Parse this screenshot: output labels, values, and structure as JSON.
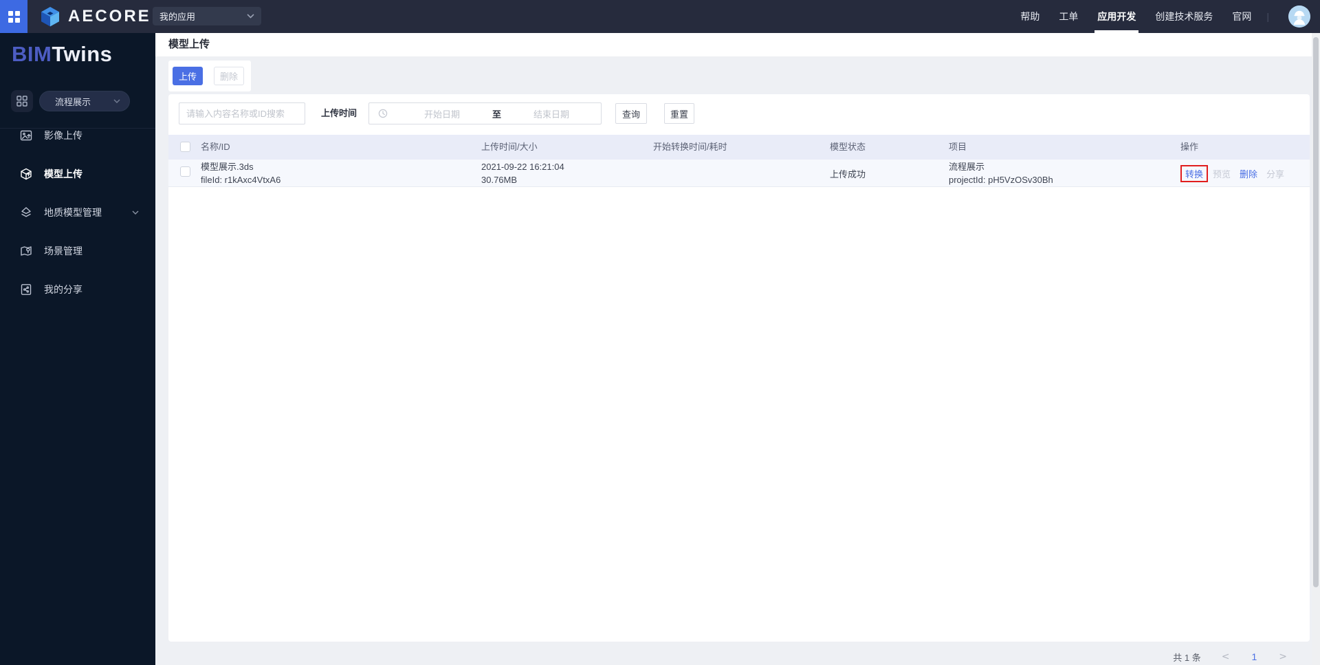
{
  "topbar": {
    "brand": "AECORE",
    "app_select": {
      "value": "我的应用"
    },
    "nav": [
      {
        "label": "帮助",
        "active": false
      },
      {
        "label": "工单",
        "active": false
      },
      {
        "label": "应用开发",
        "active": true
      },
      {
        "label": "创建技术服务",
        "active": false
      },
      {
        "label": "官网",
        "active": false
      }
    ],
    "divider": "|"
  },
  "sidebar": {
    "logo": {
      "primary": "BIM",
      "secondary": "Twins"
    },
    "project_select": {
      "value": "流程展示"
    },
    "items": [
      {
        "label": "影像上传",
        "icon": "image-upload-icon",
        "active": false,
        "has_submenu": false
      },
      {
        "label": "模型上传",
        "icon": "model-upload-icon",
        "active": true,
        "has_submenu": false
      },
      {
        "label": "地质模型管理",
        "icon": "geology-model-icon",
        "active": false,
        "has_submenu": true
      },
      {
        "label": "场景管理",
        "icon": "scene-manage-icon",
        "active": false,
        "has_submenu": false
      },
      {
        "label": "我的分享",
        "icon": "my-share-icon",
        "active": false,
        "has_submenu": false
      }
    ]
  },
  "page": {
    "title": "模型上传"
  },
  "toolbar": {
    "upload_label": "上传",
    "delete_label": "删除"
  },
  "filters": {
    "search_placeholder": "请输入内容名称或ID搜索",
    "upload_time_label": "上传时间",
    "start_date_placeholder": "开始日期",
    "to_label": "至",
    "end_date_placeholder": "结束日期",
    "query_label": "查询",
    "reset_label": "重置"
  },
  "table": {
    "headers": [
      "名称/ID",
      "上传时间/大小",
      "开始转换时间/耗时",
      "模型状态",
      "项目",
      "操作"
    ],
    "rows": [
      {
        "name": "模型展示.3ds",
        "file_id": "fileId: r1kAxc4VtxA6",
        "upload_time": "2021-09-22 16:21:04",
        "size": "30.76MB",
        "convert_time": "",
        "status": "上传成功",
        "project_name": "流程展示",
        "project_id": "projectId: pH5VzOSv30Bh",
        "actions": [
          {
            "label": "转换",
            "enabled": true,
            "highlighted": true
          },
          {
            "label": "预览",
            "enabled": false,
            "highlighted": false
          },
          {
            "label": "删除",
            "enabled": true,
            "highlighted": false
          },
          {
            "label": "分享",
            "enabled": false,
            "highlighted": false
          }
        ]
      }
    ]
  },
  "pagination": {
    "total_label": "共 1 条",
    "prev": "<",
    "current_page": "1",
    "next": ">"
  },
  "colors": {
    "accent": "#4a6fe4",
    "highlight_box": "#e11d1d",
    "topbar_bg": "#262b3d",
    "sidebar_bg": "#0b1728",
    "table_header_bg": "#e9ecf8",
    "row_bg": "#f6f8fd",
    "content_bg": "#eef0f4"
  }
}
